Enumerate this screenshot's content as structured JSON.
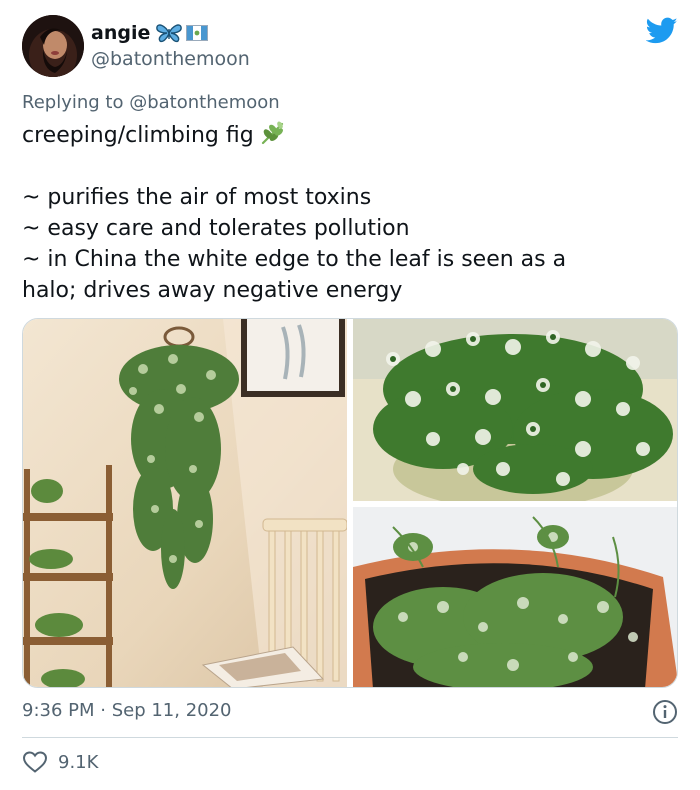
{
  "user": {
    "name": "angie",
    "handle": "@batonthemoon",
    "name_emojis": [
      "butterfly-icon",
      "guatemala-flag-icon"
    ]
  },
  "reply": {
    "prefix": "Replying to",
    "mention": "@batonthemoon"
  },
  "tweet": {
    "title_line": "creeping/climbing fig",
    "title_emoji": "herb-icon",
    "lines": [
      "~ purifies the air of most toxins",
      "~ easy care and tolerates pollution",
      "~ in China the white edge to the leaf is seen as a",
      "halo; drives away negative energy"
    ]
  },
  "media": {
    "photos": [
      "hanging-fig-plant-photo",
      "variegated-fig-closeup-photo",
      "potted-fig-photo"
    ]
  },
  "meta": {
    "timestamp": "9:36 PM · Sep 11, 2020",
    "like_count": "9.1K"
  },
  "colors": {
    "twitter_blue": "#1d9bf0",
    "text_primary": "#0f1419",
    "text_secondary": "#536471",
    "border": "#cfd9de"
  }
}
